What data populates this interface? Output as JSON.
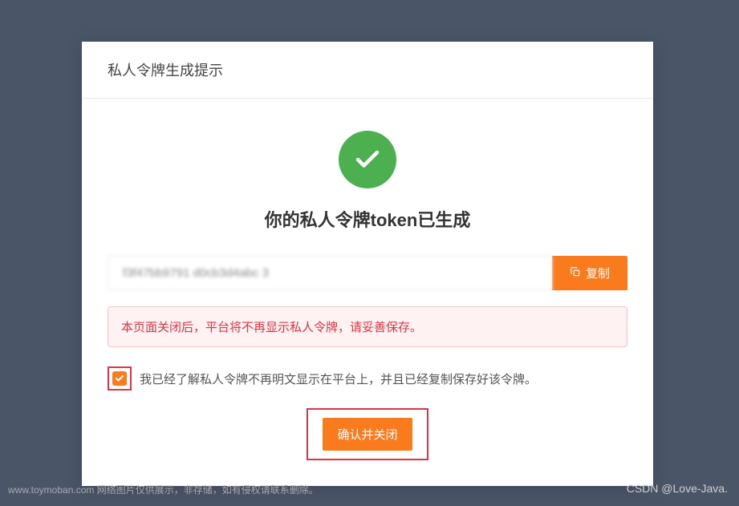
{
  "modal": {
    "title": "私人令牌生成提示",
    "success_heading": "你的私人令牌token已生成",
    "token_value": "f3f47bb9791      d0cb3d4abc     3",
    "copy_label": "复制",
    "warning_text": "本页面关闭后，平台将不再显示私人令牌，请妥善保存。",
    "consent_text": "我已经了解私人令牌不再明文显示在平台上，并且已经复制保存好该令牌。",
    "confirm_label": "确认并关闭"
  },
  "footer": {
    "attribution": "www.toymoban.com 网络图片仅供展示，非存储，如有侵权请联系删除。",
    "watermark": "CSDN @Love-Java."
  },
  "colors": {
    "accent": "#fa7a1e",
    "success": "#4caf50",
    "danger": "#dc3545",
    "highlight_border": "#dc3545"
  }
}
